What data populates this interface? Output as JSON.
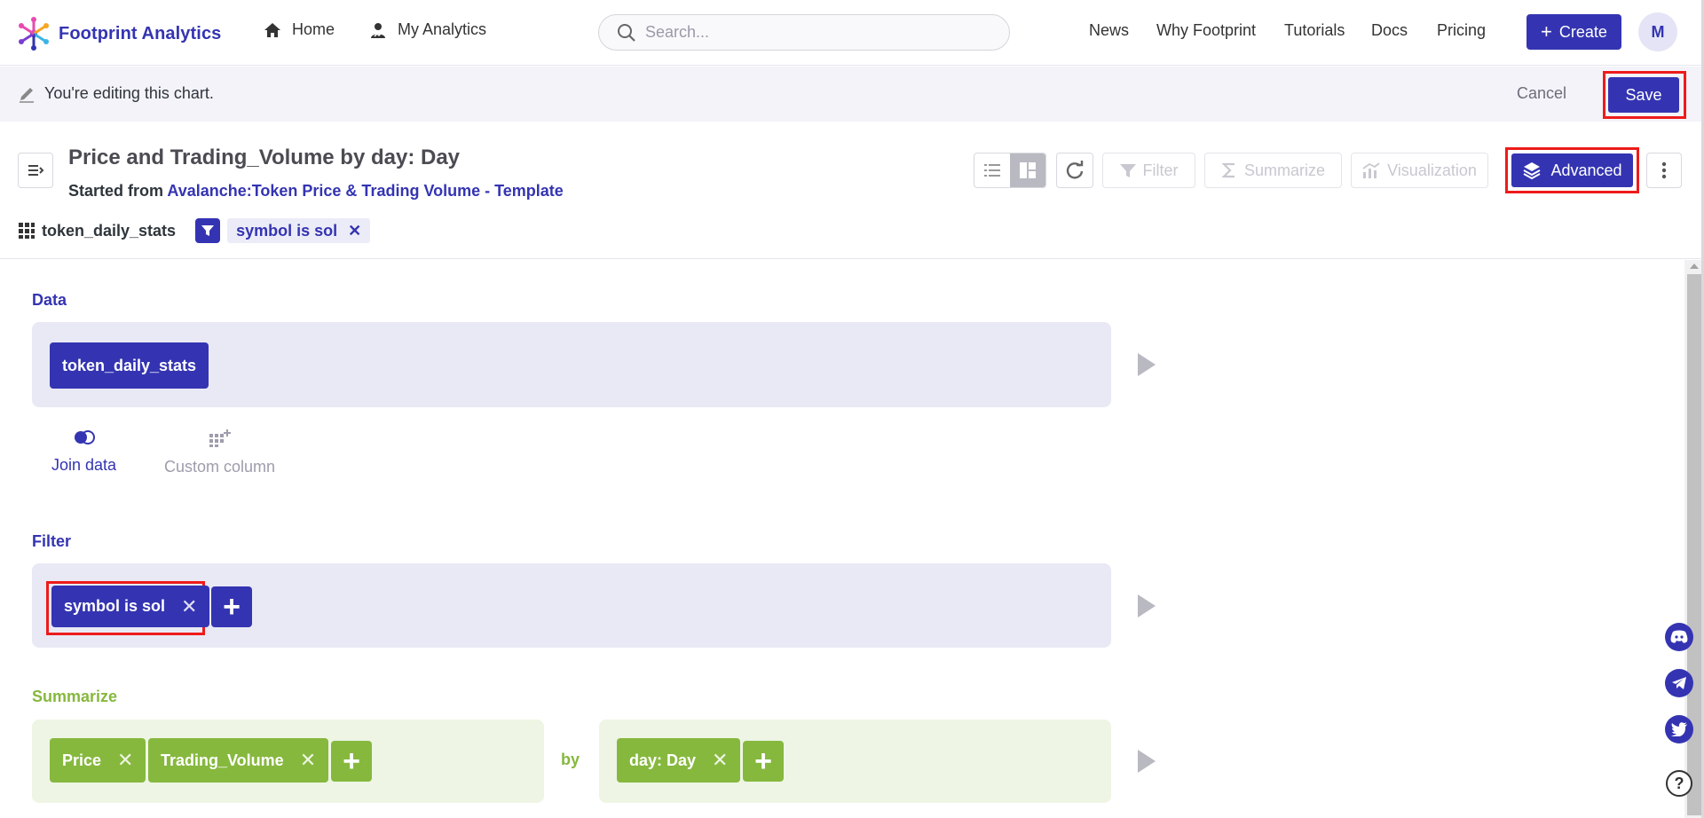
{
  "nav": {
    "logo_text": "Footprint Analytics",
    "home": "Home",
    "my_analytics": "My Analytics",
    "search_placeholder": "Search...",
    "links": [
      "News",
      "Why Footprint",
      "Tutorials",
      "Docs",
      "Pricing"
    ],
    "create_label": "Create",
    "avatar_initial": "M"
  },
  "editbar": {
    "message": "You're editing this chart.",
    "cancel_label": "Cancel",
    "save_label": "Save"
  },
  "header": {
    "title": "Price and Trading_Volume by day: Day",
    "started_from_prefix": "Started from",
    "started_from_link": "Avalanche:Token Price & Trading Volume - Template",
    "table_name": "token_daily_stats",
    "filter_pill": "symbol is sol"
  },
  "toolbar": {
    "filter_label": "Filter",
    "summarize_label": "Summarize",
    "visualization_label": "Visualization",
    "advanced_label": "Advanced"
  },
  "editor": {
    "data_label": "Data",
    "data_table": "token_daily_stats",
    "join_data_label": "Join data",
    "custom_column_label": "Custom column",
    "filter_label": "Filter",
    "filter_pill": "symbol is sol",
    "summarize_label": "Summarize",
    "metrics": [
      "Price",
      "Trading_Volume"
    ],
    "by_label": "by",
    "group_by": "day: Day"
  },
  "colors": {
    "brand": "#3434b2",
    "summarize_green": "#86b83e",
    "highlight_red": "#ee1b1b"
  }
}
